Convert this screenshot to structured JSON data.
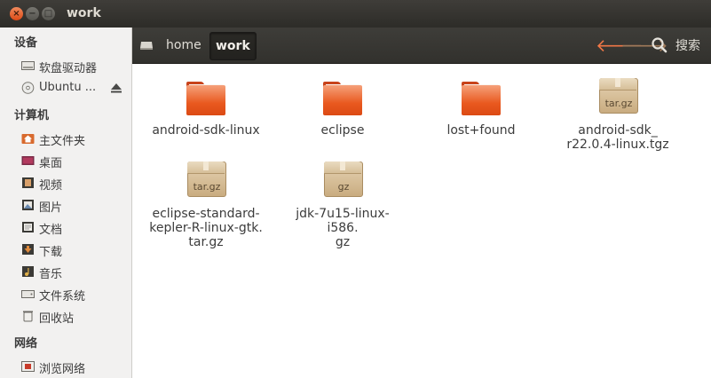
{
  "window": {
    "title": "work",
    "close_glyph": "×",
    "min_glyph": "−",
    "max_glyph": "□"
  },
  "sidebar": {
    "sections": [
      {
        "label": "设备"
      },
      {
        "label": "计算机"
      },
      {
        "label": "网络"
      }
    ],
    "devices": [
      {
        "label": "软盘驱动器",
        "icon": "floppy-drive-icon"
      },
      {
        "label": "Ubuntu ...",
        "icon": "disc-icon"
      }
    ],
    "computer": [
      {
        "label": "主文件夹",
        "icon": "home-folder-icon"
      },
      {
        "label": "桌面",
        "icon": "desktop-icon"
      },
      {
        "label": "视频",
        "icon": "video-icon"
      },
      {
        "label": "图片",
        "icon": "pictures-icon"
      },
      {
        "label": "文档",
        "icon": "documents-icon"
      },
      {
        "label": "下载",
        "icon": "downloads-icon"
      },
      {
        "label": "音乐",
        "icon": "music-icon"
      },
      {
        "label": "文件系统",
        "icon": "filesystem-icon"
      },
      {
        "label": "回收站",
        "icon": "trash-icon"
      }
    ],
    "network": [
      {
        "label": "浏览网络",
        "icon": "network-icon"
      }
    ]
  },
  "toolbar": {
    "breadcrumbs": [
      "home",
      "work"
    ],
    "back_glyph": "🡐",
    "forward_glyph": "🡒",
    "search_label": "搜索"
  },
  "files": [
    {
      "name": "android-sdk-linux",
      "type": "folder"
    },
    {
      "name": "eclipse",
      "type": "folder"
    },
    {
      "name": "lost+found",
      "type": "folder"
    },
    {
      "name": "android-sdk_\nr22.0.4-linux.tgz",
      "type": "archive",
      "badge": "tar.gz"
    },
    {
      "name": "eclipse-standard-\nkepler-R-linux-gtk.\ntar.gz",
      "type": "archive",
      "badge": "tar.gz"
    },
    {
      "name": "jdk-7u15-linux-i586.\ngz",
      "type": "archive",
      "badge": "gz"
    }
  ],
  "colors": {
    "accent": "#e9591f",
    "titlebar": "#3c3b37",
    "sidebar_bg": "#f2f1f0"
  }
}
